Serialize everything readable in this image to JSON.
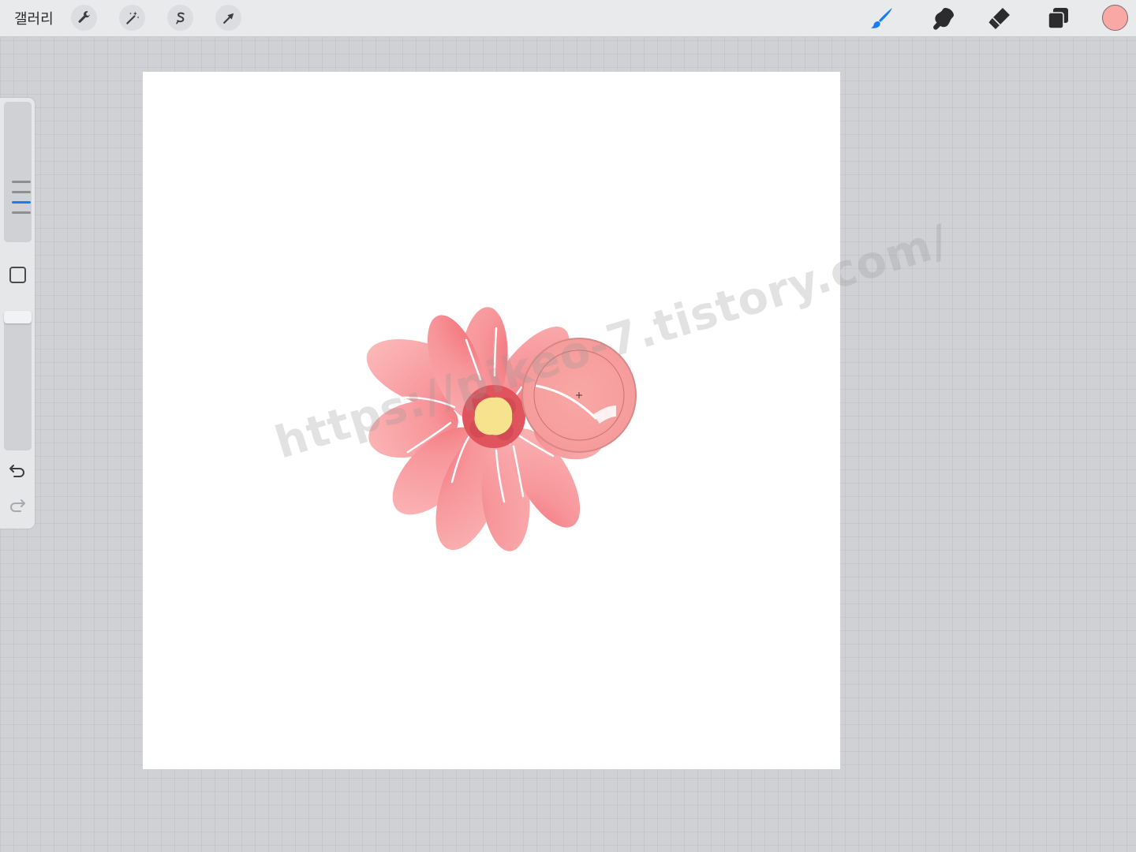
{
  "app": {
    "gallery_label": "갤러리"
  },
  "toolbar_left": [
    {
      "name": "actions-wrench-icon"
    },
    {
      "name": "adjustments-magic-wand-icon"
    },
    {
      "name": "selection-s-icon"
    },
    {
      "name": "transform-arrow-icon"
    }
  ],
  "toolbar_right": [
    {
      "name": "brush-icon",
      "active": true
    },
    {
      "name": "smudge-icon",
      "active": false
    },
    {
      "name": "eraser-icon",
      "active": false
    },
    {
      "name": "layers-icon",
      "active": false
    }
  ],
  "colors": {
    "current": "#f9a8a6",
    "accent": "#1a7cf2",
    "petal": "#f7a3a3",
    "center": "#f7e38e"
  },
  "sidebar": {
    "size_slider_icon": "size-lines-icon",
    "modify_icon": "square-icon",
    "undo_icon": "undo-icon",
    "redo_icon": "redo-icon"
  },
  "watermark": {
    "text": "https://pikeo-7.tistory.com/"
  }
}
